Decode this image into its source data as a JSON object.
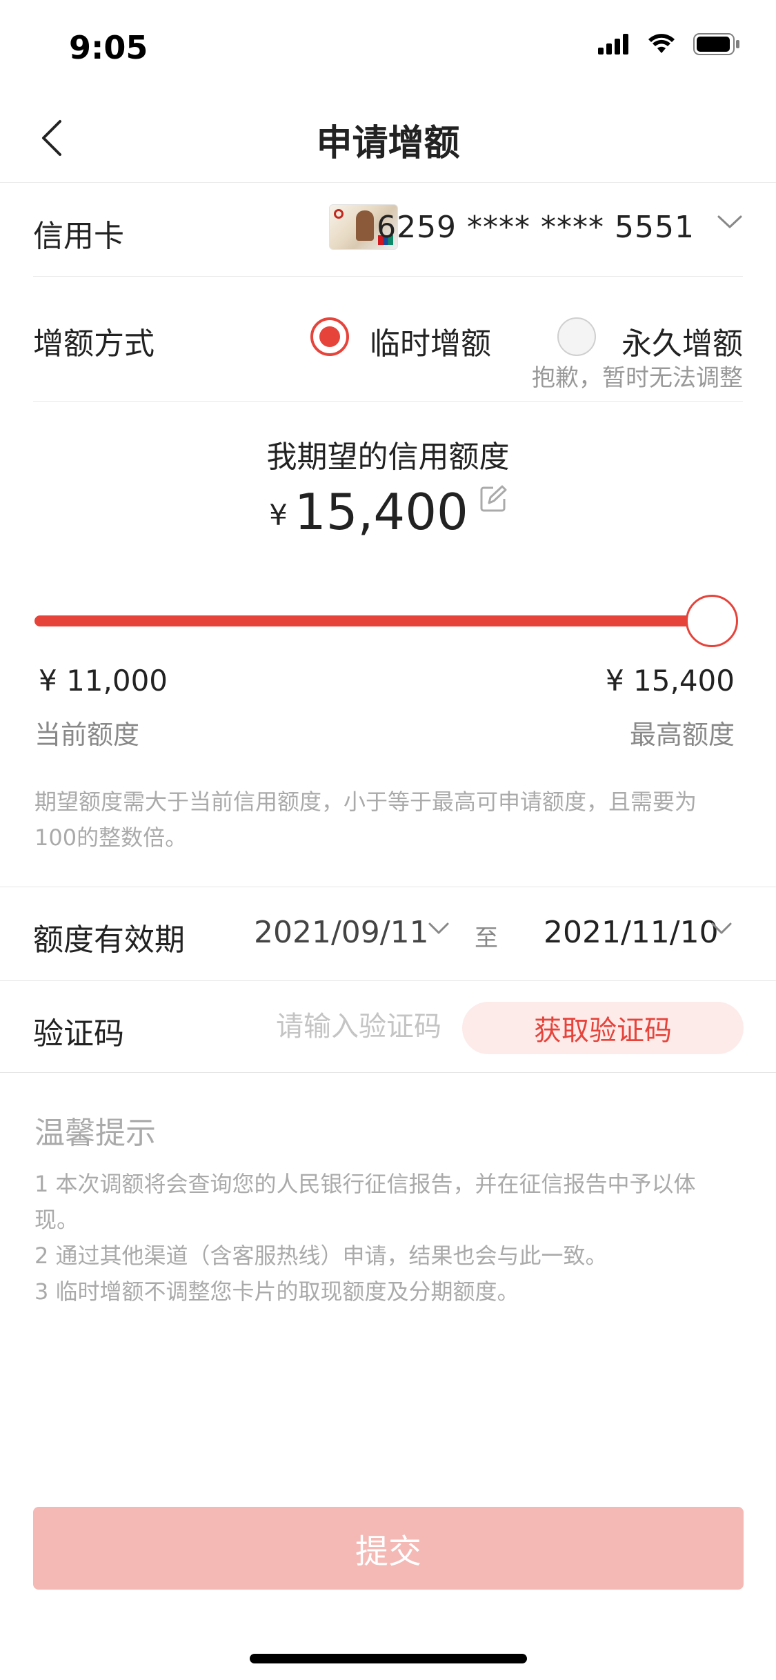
{
  "status_bar": {
    "time": "9:05",
    "icons": [
      "cellular-icon",
      "wifi-icon",
      "battery-icon"
    ]
  },
  "nav": {
    "title": "申请增额",
    "back_icon": "chevron-left-icon"
  },
  "credit_card": {
    "label": "信用卡",
    "number": "6259 **** **** 5551"
  },
  "increase_method": {
    "label": "增额方式",
    "temporary_label": "临时增额",
    "permanent_label": "永久增额",
    "selected": "临时增额",
    "permanent_note": "抱歉，暂时无法调整"
  },
  "expected_limit": {
    "title": "我期望的信用额度",
    "currency": "¥",
    "amount": "15,400"
  },
  "slider": {
    "min": 11000,
    "max": 15400,
    "value": 15400,
    "min_value": "¥ 11,000",
    "min_label": "当前额度",
    "max_value": "¥ 15,400",
    "max_label": "最高额度"
  },
  "amount_hint": "期望额度需大于当前信用额度，小于等于最高可申请额度，且需要为100的整数倍。",
  "validity": {
    "label": "额度有效期",
    "from": "2021/09/11",
    "separator": "至",
    "to": "2021/11/10"
  },
  "verification": {
    "label": "验证码",
    "placeholder": "请输入验证码",
    "get_code_label": "获取验证码"
  },
  "tips": {
    "title": "温馨提示",
    "items": [
      "1  本次调额将会查询您的人民银行征信报告，并在征信报告中予以体现。",
      "2  通过其他渠道（含客服热线）申请，结果也会与此一致。",
      "3  临时增额不调整您卡片的取现额度及分期额度。"
    ]
  },
  "submit_label": "提交",
  "colors": {
    "accent": "#e6433a",
    "submit_disabled": "#f4b9b5",
    "code_button_bg": "#fdebea"
  }
}
